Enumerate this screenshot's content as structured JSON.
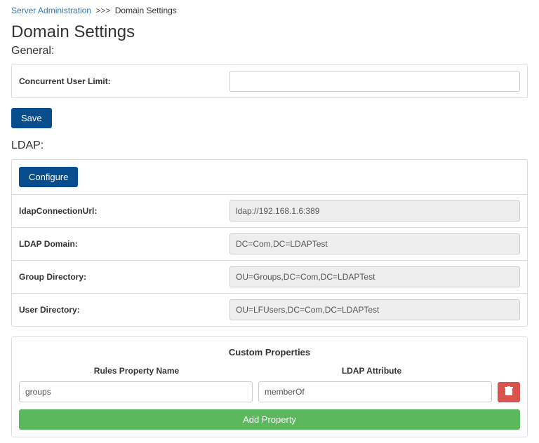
{
  "breadcrumb": {
    "root": "Server Administration",
    "sep": ">>>",
    "current": "Domain Settings"
  },
  "page_title": "Domain Settings",
  "general": {
    "heading": "General:",
    "concurrent_label": "Concurrent User Limit:",
    "concurrent_value": "",
    "save_label": "Save"
  },
  "ldap": {
    "heading": "LDAP:",
    "configure_label": "Configure",
    "fields": {
      "connection_label": "ldapConnectionUrl:",
      "connection_value": "ldap://192.168.1.6:389",
      "domain_label": "LDAP Domain:",
      "domain_value": "DC=Com,DC=LDAPTest",
      "group_label": "Group Directory:",
      "group_value": "OU=Groups,DC=Com,DC=LDAPTest",
      "user_label": "User Directory:",
      "user_value": "OU=LFUsers,DC=Com,DC=LDAPTest"
    }
  },
  "custom": {
    "title": "Custom Properties",
    "col_rule": "Rules Property Name",
    "col_ldap": "LDAP Attribute",
    "row": {
      "rule_value": "groups",
      "ldap_value": "memberOf"
    },
    "add_label": "Add Property"
  }
}
